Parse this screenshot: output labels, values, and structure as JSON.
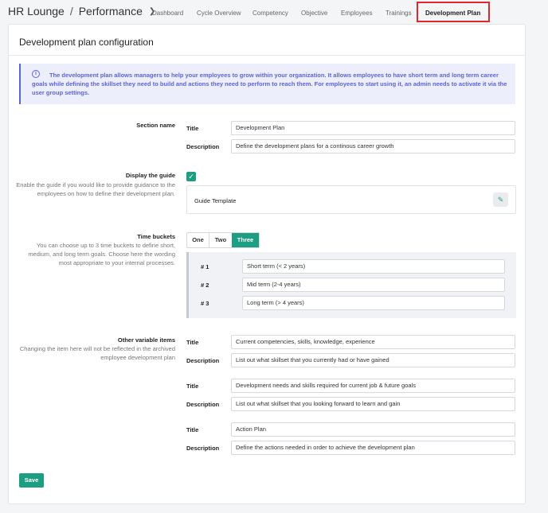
{
  "header": {
    "app": "HR Lounge",
    "separator": "/",
    "module": "Performance",
    "tabs": [
      {
        "label": "Dashboard"
      },
      {
        "label": "Cycle Overview"
      },
      {
        "label": "Competency"
      },
      {
        "label": "Objective"
      },
      {
        "label": "Employees"
      },
      {
        "label": "Trainings"
      },
      {
        "label": "Development Plan",
        "active": true
      }
    ]
  },
  "page": {
    "title": "Development plan configuration",
    "info": "The development plan allows managers to help your employees to grow within your organization. It allows employees to have short term and long term career goals while defining the skillset they need to build and actions they need to perform to reach them. For employees to start using it, an admin needs to activate it via the user group settings."
  },
  "section_name": {
    "label": "Section name",
    "title_label": "Title",
    "title_value": "Development Plan",
    "description_label": "Description",
    "description_value": "Define the development plans for a continous career growth"
  },
  "guide": {
    "label": "Display the guide",
    "help": "Enable the guide if you would like to provide guidance to the employees on how to define their development plan.",
    "checked": true,
    "template_label": "Guide Template"
  },
  "time_buckets": {
    "label": "Time buckets",
    "help": "You can choose up to 3 time buckets to define short, medium, and long term goals. Choose here the wording most appropriate to your internal processes.",
    "options": [
      "One",
      "Two",
      "Three"
    ],
    "selected": "Three",
    "buckets": [
      {
        "num": "# 1",
        "value": "Short term (< 2 years)"
      },
      {
        "num": "# 2",
        "value": "Mid term (2-4 years)"
      },
      {
        "num": "# 3",
        "value": "Long term (> 4 years)"
      }
    ]
  },
  "variable_items": {
    "label": "Other variable items",
    "help": "Changing the item here will not be reflected in the archived employee development plan",
    "title_label": "Title",
    "description_label": "Description",
    "items": [
      {
        "title": "Current competencies, skills, knowledge, experience",
        "description": "List out what skillset that you currently had or have gained"
      },
      {
        "title": "Development needs and skills required for current job & future goals",
        "description": "List out what skillset that you looking forward to learn and gain"
      },
      {
        "title": "Action Plan",
        "description": "Define the actions needed in order to achieve the development plan"
      }
    ]
  },
  "actions": {
    "save_label": "Save"
  },
  "colors": {
    "accent": "#1d9e83",
    "info_text": "#5e63d6",
    "highlight": "#e0272f"
  }
}
